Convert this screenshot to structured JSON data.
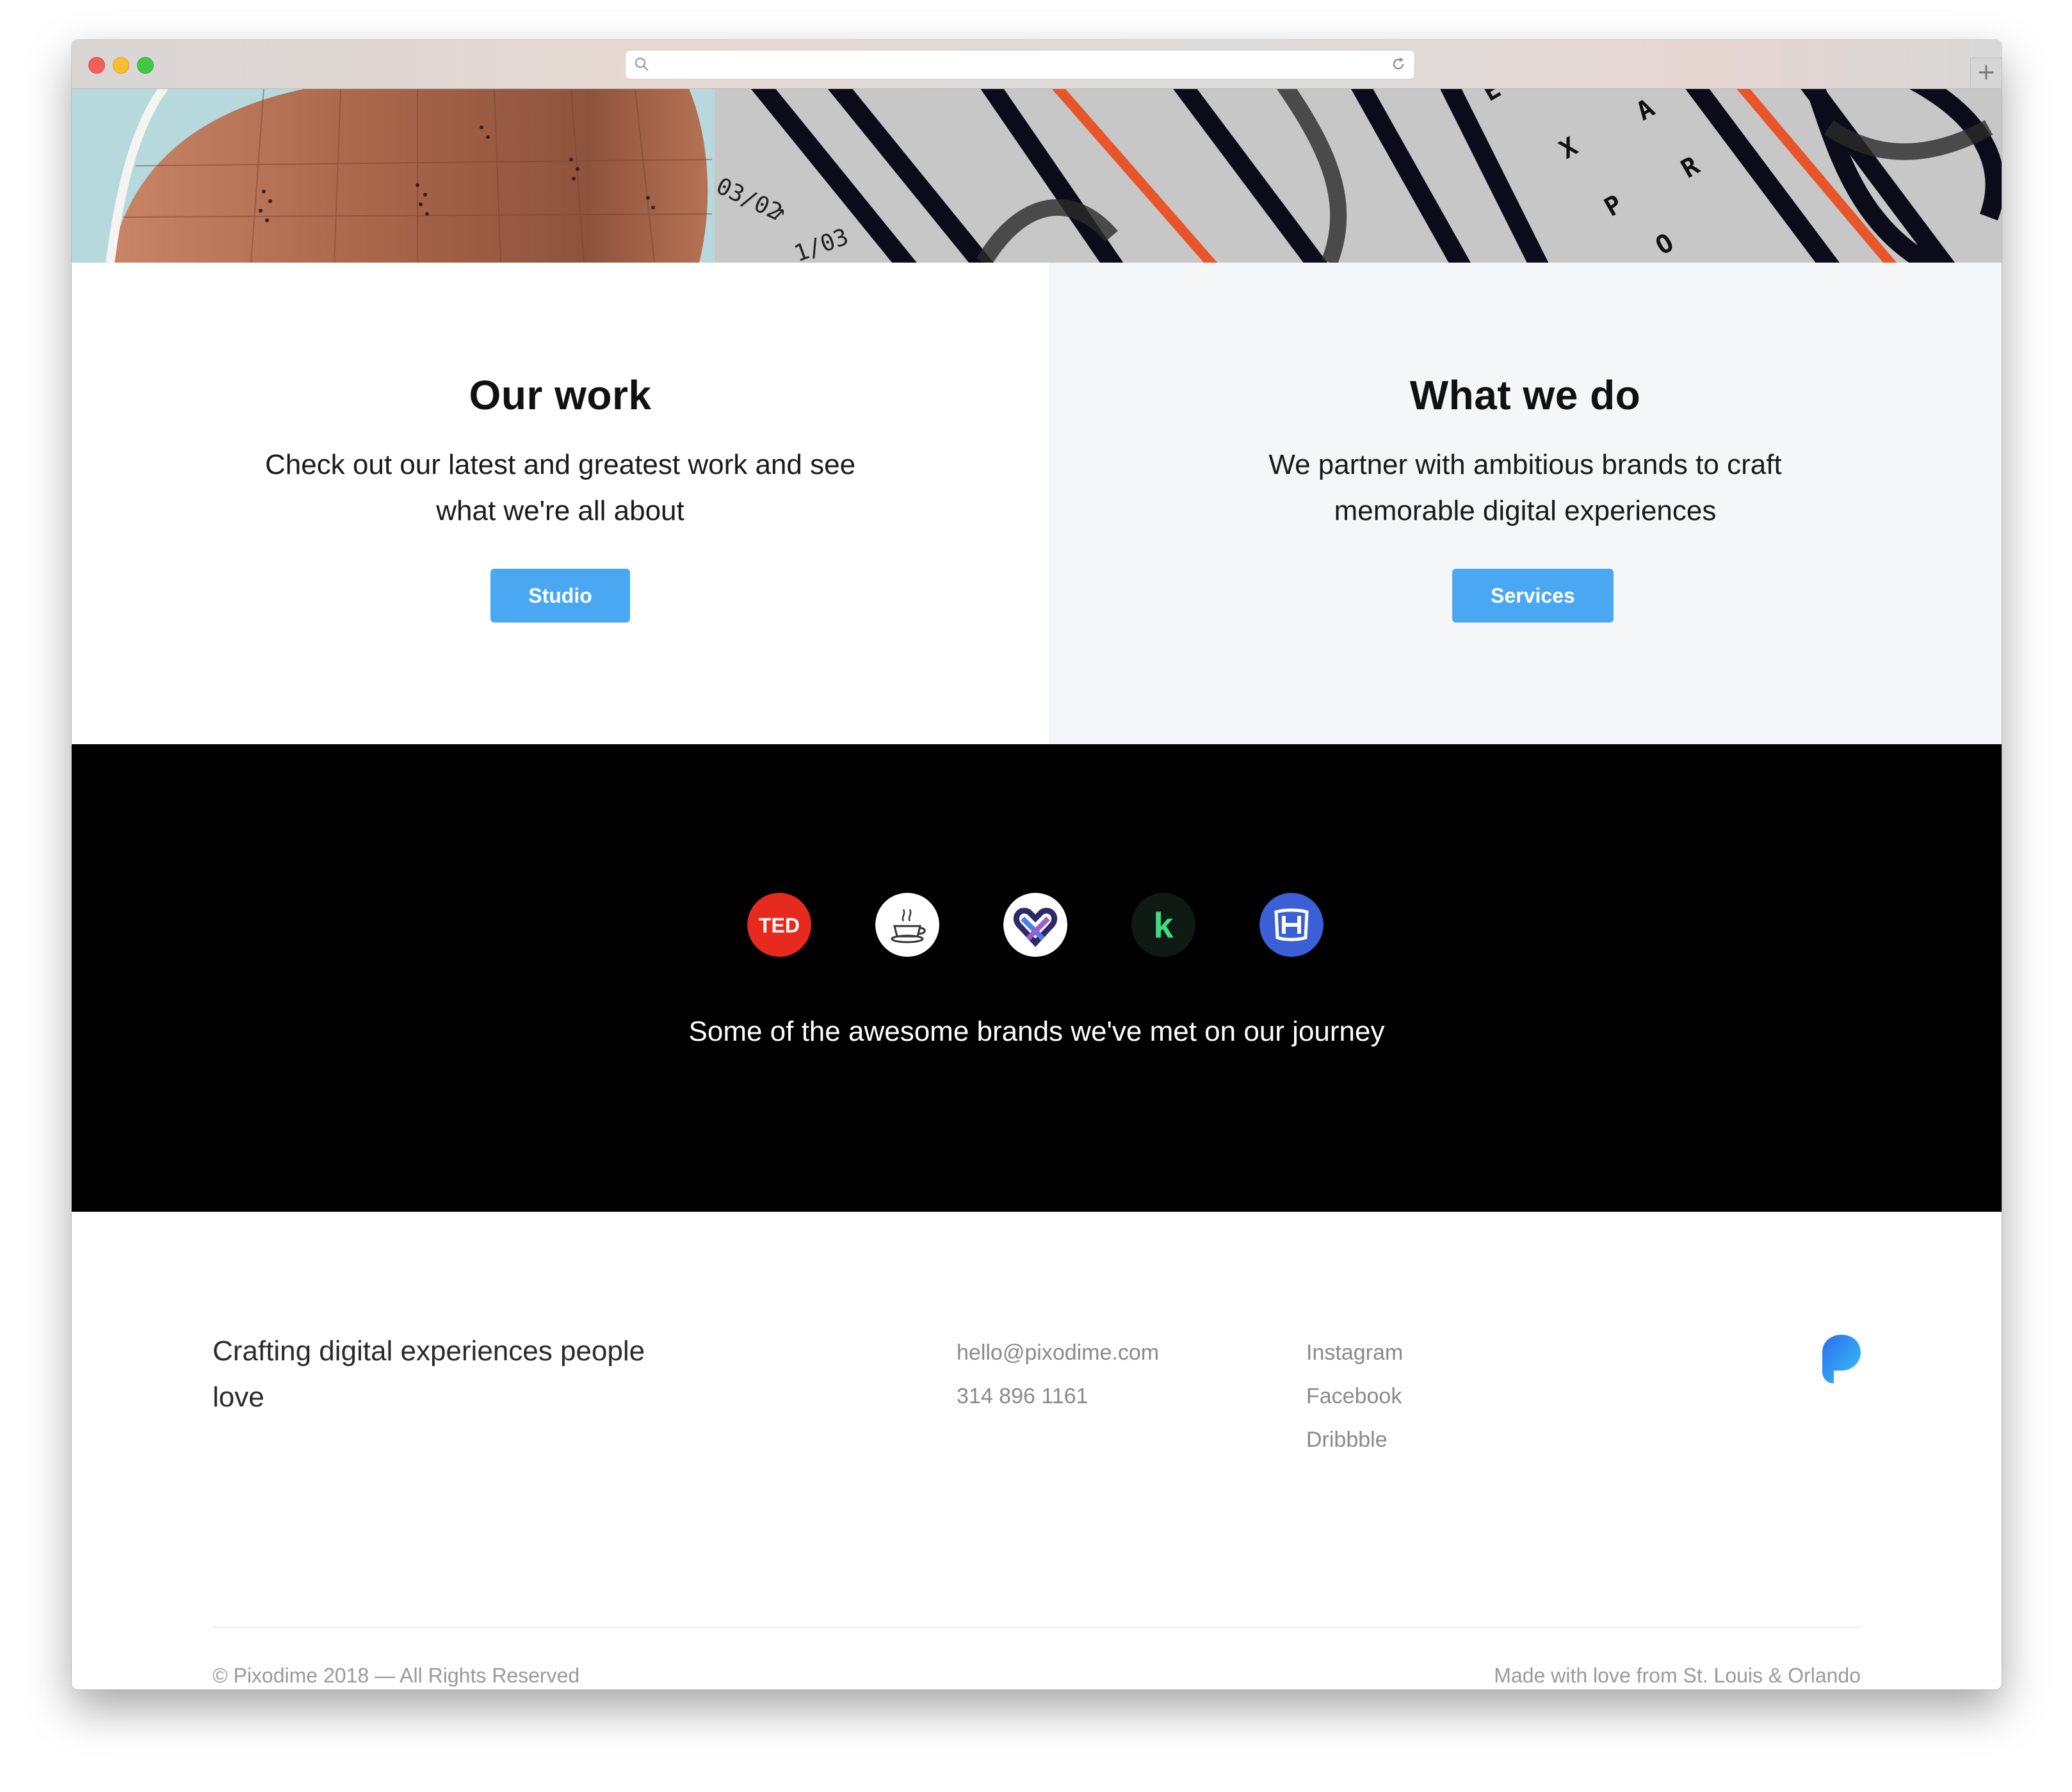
{
  "browser": {
    "url": "",
    "new_tab_label": "+"
  },
  "sections": {
    "work": {
      "title": "Our work",
      "description": "Check out our latest and greatest work and see what we're all about",
      "button_label": "Studio"
    },
    "services": {
      "title": "What we do",
      "description": "We partner with ambitious brands to craft memorable digital experiences",
      "button_label": "Services"
    }
  },
  "brands": {
    "logos": [
      {
        "name": "ted-logo",
        "label": "TED",
        "bg": "#e62b1e"
      },
      {
        "name": "coffee-cup-logo",
        "bg": "#ffffff"
      },
      {
        "name": "heart-knot-logo",
        "bg": "#ffffff"
      },
      {
        "name": "k-logo",
        "label": "k",
        "bg": "#0f1a14",
        "fg": "#3ddc84"
      },
      {
        "name": "honda-logo",
        "bg": "#3b5fd6"
      }
    ],
    "caption": "Some of the awesome brands we've met on our journey"
  },
  "footer": {
    "tagline": "Crafting digital experiences people love",
    "email": "hello@pixodime.com",
    "phone": "314 896 1161",
    "social": [
      "Instagram",
      "Facebook",
      "Dribbble"
    ],
    "copyright": "© Pixodime 2018 — All Rights Reserved",
    "made_with": "Made with love from St. Louis & Orlando"
  },
  "colors": {
    "accent_button": "#4aa8f2",
    "brand_band_bg": "#000000",
    "services_bg": "#f5f6f8"
  }
}
